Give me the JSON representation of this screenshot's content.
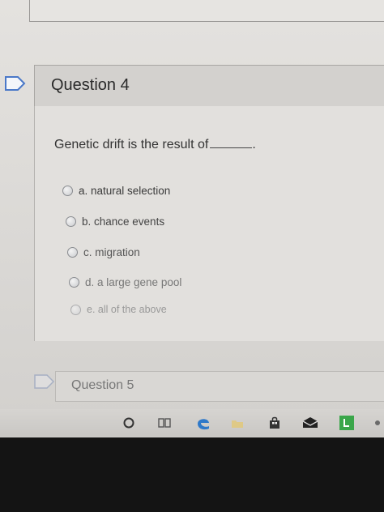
{
  "question4": {
    "title": "Question 4",
    "prompt": "Genetic drift is the result of",
    "prompt_end": ".",
    "options": [
      {
        "label": "a. natural selection"
      },
      {
        "label": "b. chance events"
      },
      {
        "label": "c. migration"
      },
      {
        "label": "d. a large gene pool"
      },
      {
        "label": "e. all of the above"
      }
    ]
  },
  "question5": {
    "title": "Question 5"
  },
  "colors": {
    "flag_accent": "#4a78c8",
    "edge_icon": "#2f79c9",
    "launcher_green": "#3aa64a"
  },
  "taskbar_icons": [
    "cortana-circle-icon",
    "task-view-icon",
    "edge-icon",
    "file-explorer-icon",
    "store-icon",
    "mail-icon",
    "launcher-icon"
  ]
}
